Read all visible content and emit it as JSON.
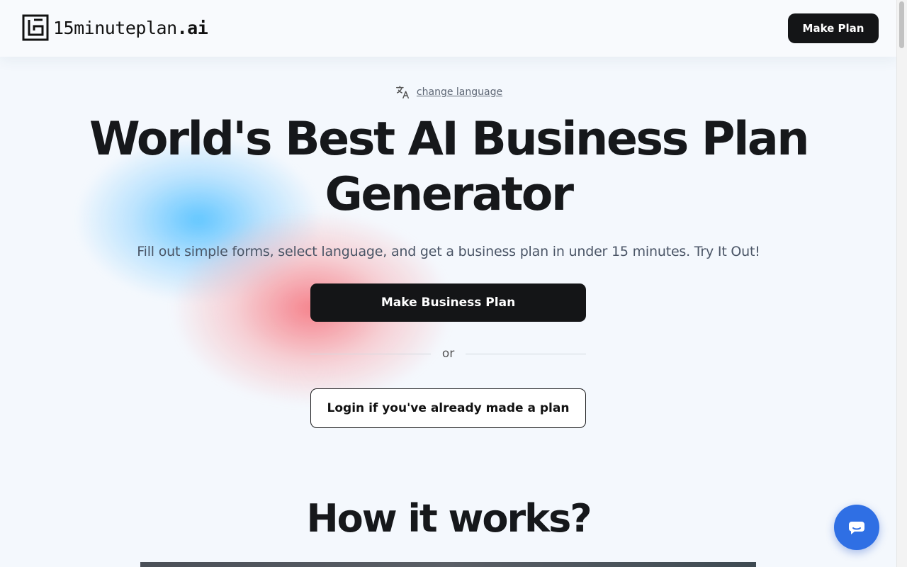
{
  "header": {
    "logo_text": "15minuteplan",
    "logo_suffix": ".ai",
    "make_plan_label": "Make Plan"
  },
  "language": {
    "icon": "translate-icon",
    "link_label": "change language"
  },
  "hero": {
    "title": "World's Best AI Business Plan Generator",
    "subtitle": "Fill out simple forms, select language, and get a business plan in under 15 minutes. Try It Out!",
    "primary_label": "Make Business Plan",
    "divider_text": "or",
    "secondary_label": "Login if you've already made a plan"
  },
  "how_it_works": {
    "title": "How it works?"
  },
  "chat": {
    "icon": "chat-icon"
  },
  "colors": {
    "accent_dark": "#141517",
    "chat_blue": "#2f6fe4",
    "background": "#f4f8fd"
  }
}
